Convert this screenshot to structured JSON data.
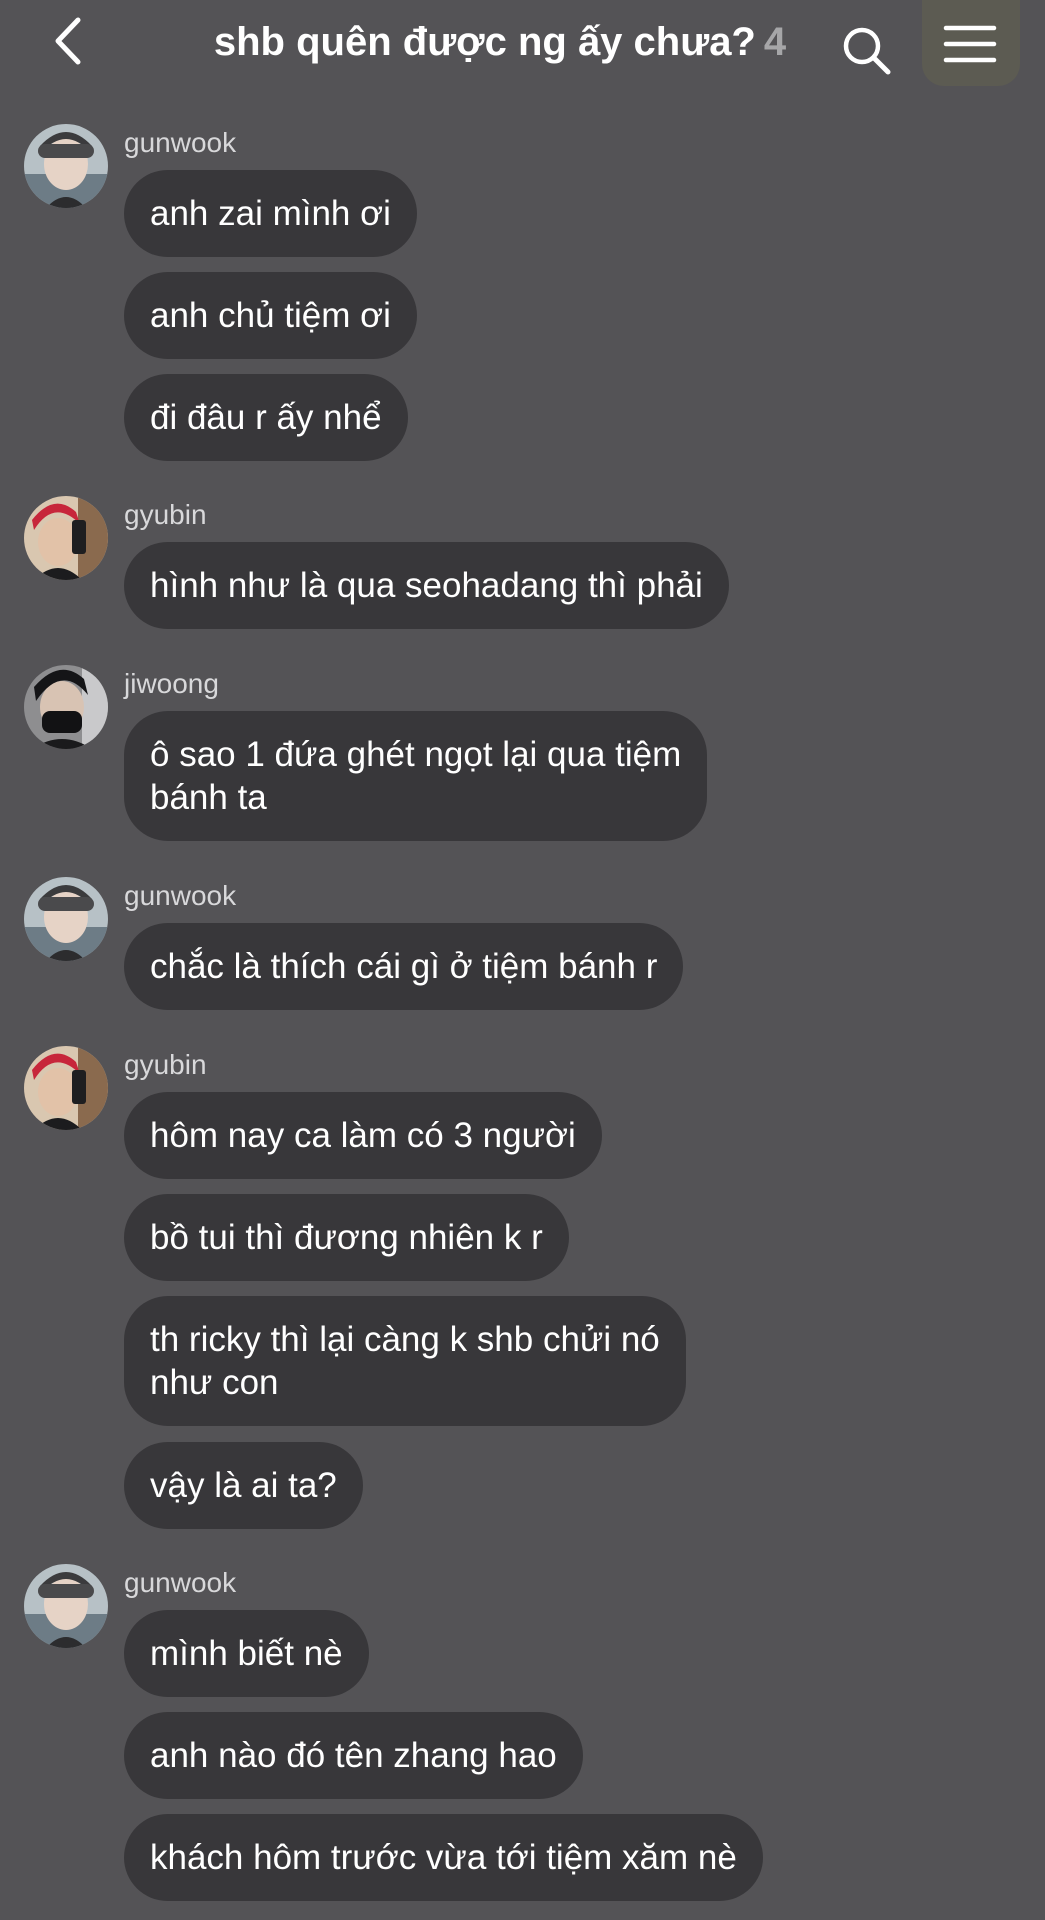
{
  "header": {
    "title": "shb quên được ng ấy chưa?",
    "member_count": "4",
    "back_icon": "chevron-left-icon",
    "search_icon": "search-icon",
    "menu_icon": "hamburger-menu-icon"
  },
  "colors": {
    "background": "#545356",
    "bubble": "#38373a",
    "text": "#ffffff",
    "sender": "#d8d8da",
    "count": "#a6a6a8"
  },
  "messages": [
    {
      "sender": "gunwook",
      "bubbles": [
        "anh zai mình ơi",
        "anh chủ tiệm ơi",
        "đi đâu r ấy nhể"
      ]
    },
    {
      "sender": "gyubin",
      "bubbles": [
        "hình như là qua seohadang thì phải"
      ]
    },
    {
      "sender": "jiwoong",
      "bubbles": [
        "ô sao 1 đứa ghét ngọt lại qua tiệm\nbánh ta"
      ]
    },
    {
      "sender": "gunwook",
      "bubbles": [
        "chắc là thích cái gì ở tiệm bánh r"
      ]
    },
    {
      "sender": "gyubin",
      "bubbles": [
        "hôm nay ca làm có 3 người",
        "bồ tui thì đương nhiên k r",
        "th ricky thì lại càng k shb chửi nó\nnhư con",
        "vậy là ai ta?"
      ]
    },
    {
      "sender": "gunwook",
      "bubbles": [
        "mình biết nè",
        "anh nào đó tên zhang hao",
        "khách hôm trước vừa tới tiệm xăm nè"
      ]
    }
  ]
}
